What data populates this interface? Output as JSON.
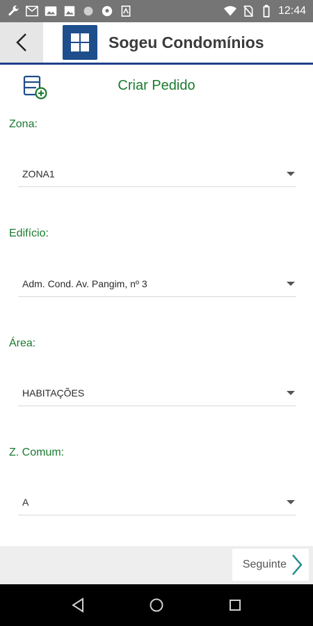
{
  "status_bar": {
    "time": "12:44",
    "left_icons": [
      "wrench-icon",
      "gmail-icon",
      "image-icon",
      "photo-icon",
      "circle-icon",
      "soccer-icon",
      "nfc-icon"
    ],
    "right_icons": [
      "wifi-icon",
      "no-sim-icon",
      "battery-icon"
    ]
  },
  "app_bar": {
    "title": "Sogeu Condomínios",
    "colors": {
      "logo": "#1f4e8c",
      "divider": "#1f3f8a"
    }
  },
  "page": {
    "title": "Criar Pedido",
    "accent": "#1a7a2e"
  },
  "form": {
    "zona": {
      "label": "Zona:",
      "value": "ZONA1"
    },
    "edificio": {
      "label": "Edifício:",
      "value": "Adm. Cond. Av. Pangim, nº 3"
    },
    "area": {
      "label": "Área:",
      "value": "HABITAÇÕES"
    },
    "zcomum": {
      "label": "Z. Comum:",
      "value": "A"
    }
  },
  "footer": {
    "next_label": "Seguinte"
  }
}
